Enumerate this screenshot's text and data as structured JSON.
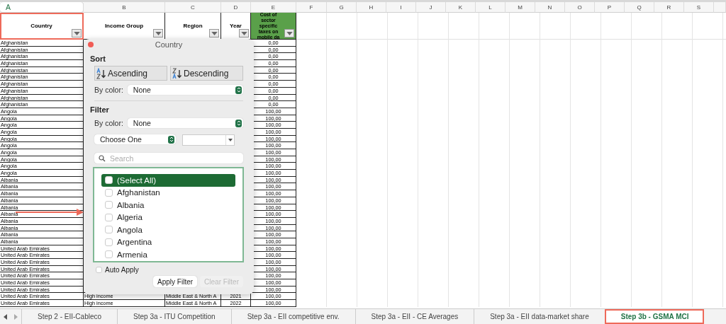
{
  "columns": [
    {
      "letter": "A",
      "selected": true
    },
    {
      "letter": "B",
      "selected": false
    },
    {
      "letter": "C",
      "selected": false
    },
    {
      "letter": "D",
      "selected": false
    },
    {
      "letter": "E",
      "selected": false
    },
    {
      "letter": "F",
      "selected": false
    },
    {
      "letter": "G",
      "selected": false
    },
    {
      "letter": "H",
      "selected": false
    },
    {
      "letter": "I",
      "selected": false
    },
    {
      "letter": "J",
      "selected": false
    },
    {
      "letter": "K",
      "selected": false
    },
    {
      "letter": "L",
      "selected": false
    },
    {
      "letter": "M",
      "selected": false
    },
    {
      "letter": "N",
      "selected": false
    },
    {
      "letter": "O",
      "selected": false
    },
    {
      "letter": "P",
      "selected": false
    },
    {
      "letter": "Q",
      "selected": false
    },
    {
      "letter": "R",
      "selected": false
    },
    {
      "letter": "S",
      "selected": false
    }
  ],
  "headers": [
    {
      "text": "Country",
      "highlighted": false,
      "annotated": true
    },
    {
      "text": "Income Group",
      "highlighted": false,
      "annotated": false
    },
    {
      "text": "Region",
      "highlighted": false,
      "annotated": false
    },
    {
      "text": "Year",
      "highlighted": false,
      "annotated": false
    },
    {
      "text": "Cost of sector specific taxes on mobile da",
      "highlighted": true,
      "annotated": false
    }
  ],
  "rows": [
    {
      "country": "Afghanistan",
      "value": "0,00"
    },
    {
      "country": "Afghanistan",
      "value": "0,00"
    },
    {
      "country": "Afghanistan",
      "value": "0,00"
    },
    {
      "country": "Afghanistan",
      "value": "0,00"
    },
    {
      "country": "Afghanistan",
      "value": "0,00"
    },
    {
      "country": "Afghanistan",
      "value": "0,00"
    },
    {
      "country": "Afghanistan",
      "value": "0,00"
    },
    {
      "country": "Afghanistan",
      "value": "0,00"
    },
    {
      "country": "Afghanistan",
      "value": "0,00"
    },
    {
      "country": "Afghanistan",
      "value": "0,00"
    },
    {
      "country": "Angola",
      "value": "100,00"
    },
    {
      "country": "Angola",
      "value": "100,00"
    },
    {
      "country": "Angola",
      "value": "100,00"
    },
    {
      "country": "Angola",
      "value": "100,00"
    },
    {
      "country": "Angola",
      "value": "100,00"
    },
    {
      "country": "Angola",
      "value": "100,00"
    },
    {
      "country": "Angola",
      "value": "100,00"
    },
    {
      "country": "Angola",
      "value": "100,00"
    },
    {
      "country": "Angola",
      "value": "100,00"
    },
    {
      "country": "Angola",
      "value": "100,00"
    },
    {
      "country": "Albania",
      "value": "100,00"
    },
    {
      "country": "Albania",
      "value": "100,00"
    },
    {
      "country": "Albania",
      "value": "100,00"
    },
    {
      "country": "Albania",
      "value": "100,00"
    },
    {
      "country": "Albania",
      "value": "100,00"
    },
    {
      "country": "Albania",
      "value": "100,00"
    },
    {
      "country": "Albania",
      "value": "100,00"
    },
    {
      "country": "Albania",
      "value": "100,00"
    },
    {
      "country": "Albania",
      "value": "100,00"
    },
    {
      "country": "Albania",
      "value": "100,00"
    },
    {
      "country": "United Arab Emirates",
      "value": "100,00"
    },
    {
      "country": "United Arab Emirates",
      "value": "100,00"
    },
    {
      "country": "United Arab Emirates",
      "value": "100,00"
    },
    {
      "country": "United Arab Emirates",
      "value": "100,00"
    },
    {
      "country": "United Arab Emirates",
      "value": "100,00"
    },
    {
      "country": "United Arab Emirates",
      "value": "100,00"
    },
    {
      "country": "United Arab Emirates",
      "value": "100,00"
    },
    {
      "country": "United Arab Emirates",
      "income_group": "High income",
      "region": "Middle East & North A",
      "year": "2021",
      "value": "100,00"
    },
    {
      "country": "United Arab Emirates",
      "income_group": "High income",
      "region": "Middle East & North A",
      "year": "2022",
      "value": "100,00"
    }
  ],
  "filter_popup": {
    "title": "Country",
    "sort_label": "Sort",
    "ascending": "Ascending",
    "descending": "Descending",
    "sort_by_color_label": "By color:",
    "sort_by_color": "None",
    "filter_label": "Filter",
    "filter_by_color_label": "By color:",
    "filter_by_color": "None",
    "condition": "Choose One",
    "search_placeholder": "Search",
    "items": [
      {
        "label": "(Select All)",
        "checked": false,
        "selected": true
      },
      {
        "label": "Afghanistan",
        "checked": false,
        "selected": false
      },
      {
        "label": "Albania",
        "checked": false,
        "selected": false
      },
      {
        "label": "Algeria",
        "checked": false,
        "selected": false
      },
      {
        "label": "Angola",
        "checked": false,
        "selected": false
      },
      {
        "label": "Argentina",
        "checked": false,
        "selected": false
      },
      {
        "label": "Armenia",
        "checked": false,
        "selected": false
      }
    ],
    "auto_apply": {
      "label": "Auto Apply",
      "checked": false
    },
    "apply_button": {
      "label": "Apply Filter",
      "disabled": false
    },
    "clear_button": {
      "label": "Clear Filter",
      "disabled": true
    }
  },
  "sheet_tabs": [
    {
      "label": "Step 2 - EII-Cableco",
      "selected": false,
      "annotated": false
    },
    {
      "label": "Step 3a - ITU Competition",
      "selected": false,
      "annotated": false
    },
    {
      "label": "Step 3a - EII competitive env.",
      "selected": false,
      "annotated": false
    },
    {
      "label": "Step 3a - EII - CE Averages",
      "selected": false,
      "annotated": false
    },
    {
      "label": "Step 3a - EII data-market share",
      "selected": false,
      "annotated": false
    },
    {
      "label": "Step 3b - GSMA MCI",
      "selected": true,
      "annotated": true
    }
  ]
}
